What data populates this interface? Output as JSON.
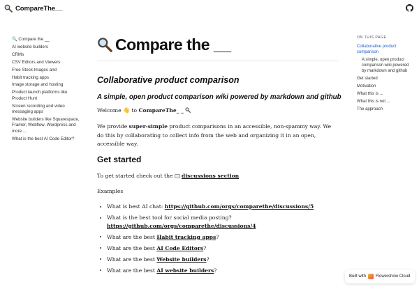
{
  "navbar": {
    "brand": "CompareThe__"
  },
  "sidebar": {
    "items": [
      "🔍 Compare the __",
      "AI website builders",
      "CRMs",
      "CSV Editors and Viewers",
      "Free Stock Images and",
      "Habit tracking apps",
      "Image storage and hosting",
      "Product launch platforms like Product Hunt",
      "Screen recording and video messaging apps",
      "Website builders like Squarespace, Framer, Webflow, Wordpress and more ...",
      "What is the best AI Code Editor?"
    ]
  },
  "main": {
    "title": "Compare the __",
    "subtitle": "Collaborative product comparison",
    "tagline": "A simple, open product comparison wiki powered by markdown and github",
    "welcome_prefix": "Welcome",
    "welcome_hand": "👋",
    "welcome_to": "to",
    "welcome_brand": "CompareThe_ _",
    "p2_prefix": "We provide",
    "p2_bold": "super-simple",
    "p2_rest": "product comparisons in an accessible, non-spammy way. We do this by collaborating to collect info from the web and organizing it in an open, accessible way.",
    "get_started": "Get started",
    "get_started_text": "To get started check out the",
    "discussions_link": "discussions section",
    "examples": "Examples",
    "list": [
      {
        "prefix": "What is best AI chat: ",
        "link": "https://github.com/orgs/comparethe/discussions/5",
        "suffix": ""
      },
      {
        "prefix": "What is the best tool for social media posting? ",
        "link": "https://github.com/orgs/comparethe/discussions/4",
        "suffix": ""
      },
      {
        "prefix": "What are the best ",
        "link": "Habit tracking apps",
        "suffix": "?"
      },
      {
        "prefix": "What are the best ",
        "link": "AI Code Editors",
        "suffix": "?"
      },
      {
        "prefix": "What are the best ",
        "link": "Website builders",
        "suffix": "?"
      },
      {
        "prefix": "What are the best ",
        "link": "AI website builders",
        "suffix": "?"
      }
    ]
  },
  "toc": {
    "title": "ON THIS PAGE",
    "items": [
      {
        "label": "Collaborative product comparison",
        "active": true,
        "sub": false
      },
      {
        "label": "A simple, open product comparison wiki powered by markdown and github",
        "active": false,
        "sub": true
      },
      {
        "label": "Get started",
        "active": false,
        "sub": false
      },
      {
        "label": "Motivation",
        "active": false,
        "sub": false
      },
      {
        "label": "What this is ...",
        "active": false,
        "sub": false
      },
      {
        "label": "What this is not ...",
        "active": false,
        "sub": false
      },
      {
        "label": "The approach",
        "active": false,
        "sub": false
      }
    ]
  },
  "footer": {
    "built_with": "Built with",
    "provider": "Flowershow Cloud"
  },
  "colors": {
    "accent": "#1a5ec8",
    "text": "#1a1a1a"
  },
  "icons": {
    "brand": "magnifier-icon",
    "github": "github-icon"
  }
}
